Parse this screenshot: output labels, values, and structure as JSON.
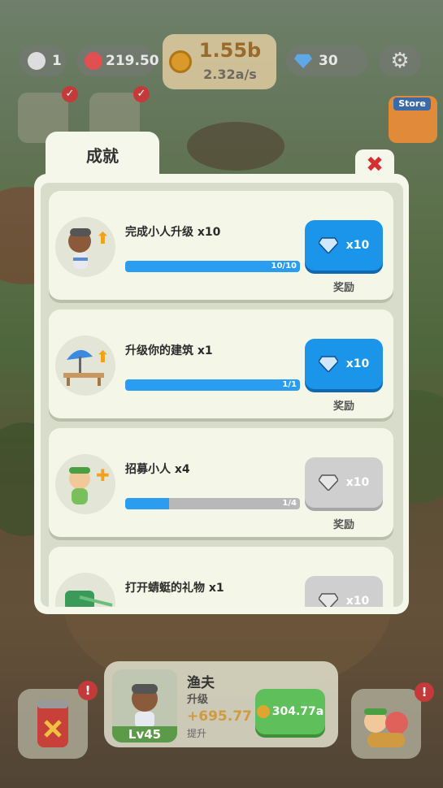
{
  "hud": {
    "seeds": "1",
    "hearts": "219.50",
    "coins": "1.55b",
    "coin_rate": "2.32a/s",
    "gems": "30"
  },
  "store_label": "Store",
  "modal": {
    "title": "成就",
    "close_symbol": "✖",
    "tasks": [
      {
        "title": "完成小人升级 x10",
        "progress_text": "10/10",
        "progress": 1.0,
        "reward": "x10",
        "reward_label": "奖励",
        "claimable": true,
        "icon": "worker-upgrade-icon"
      },
      {
        "title": "升级你的建筑 x1",
        "progress_text": "1/1",
        "progress": 1.0,
        "reward": "x10",
        "reward_label": "奖励",
        "claimable": true,
        "icon": "building-upgrade-icon"
      },
      {
        "title": "招募小人 x4",
        "progress_text": "1/4",
        "progress": 0.25,
        "reward": "x10",
        "reward_label": "奖励",
        "claimable": false,
        "icon": "recruit-icon"
      },
      {
        "title": "打开蜻蜓的礼物 x1",
        "progress_text": "",
        "progress": 0,
        "reward": "x10",
        "reward_label": "",
        "claimable": false,
        "icon": "dragonfly-gift-icon"
      }
    ]
  },
  "worker": {
    "name": "渔夫",
    "action": "升级",
    "level": "Lv45",
    "gain": "+695.77",
    "gain_label": "提升",
    "cost": "304.77a"
  },
  "colors": {
    "accent_blue": "#1a95ea",
    "progress_blue": "#2b9df0",
    "upgrade_green": "#5fbf5a",
    "alert_red": "#c43a3a"
  }
}
